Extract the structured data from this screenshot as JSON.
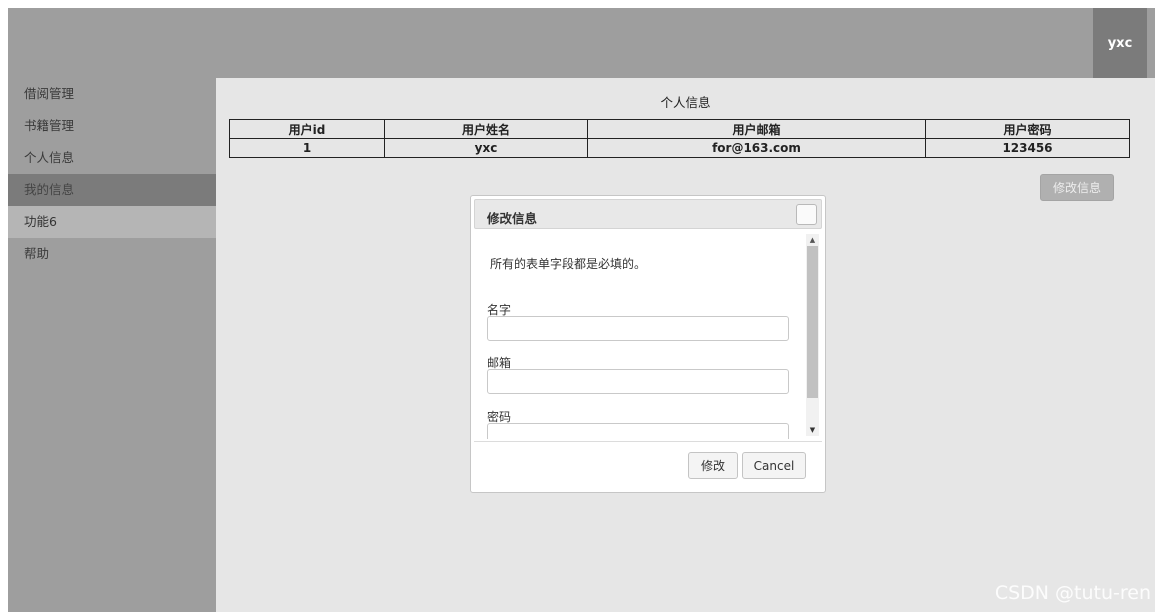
{
  "header": {
    "user": "yxc"
  },
  "sidebar": {
    "items": [
      {
        "label": "借阅管理"
      },
      {
        "label": "书籍管理"
      },
      {
        "label": "个人信息"
      },
      {
        "label": "我的信息"
      },
      {
        "label": "功能6"
      },
      {
        "label": "帮助"
      }
    ]
  },
  "main": {
    "title": "个人信息",
    "table": {
      "columns": [
        "用户id",
        "用户姓名",
        "用户邮箱",
        "用户密码"
      ],
      "rows": [
        [
          "1",
          "yxc",
          "for@163.com",
          "123456"
        ]
      ]
    },
    "edit_button": "修改信息"
  },
  "dialog": {
    "title": "修改信息",
    "tips": "所有的表单字段都是必填的。",
    "fields": [
      {
        "label": "名字",
        "value": ""
      },
      {
        "label": "邮箱",
        "value": ""
      },
      {
        "label": "密码",
        "value": ""
      }
    ],
    "submit_button": "修改",
    "cancel_button": "Cancel"
  },
  "watermark": "CSDN @tutu-ren"
}
